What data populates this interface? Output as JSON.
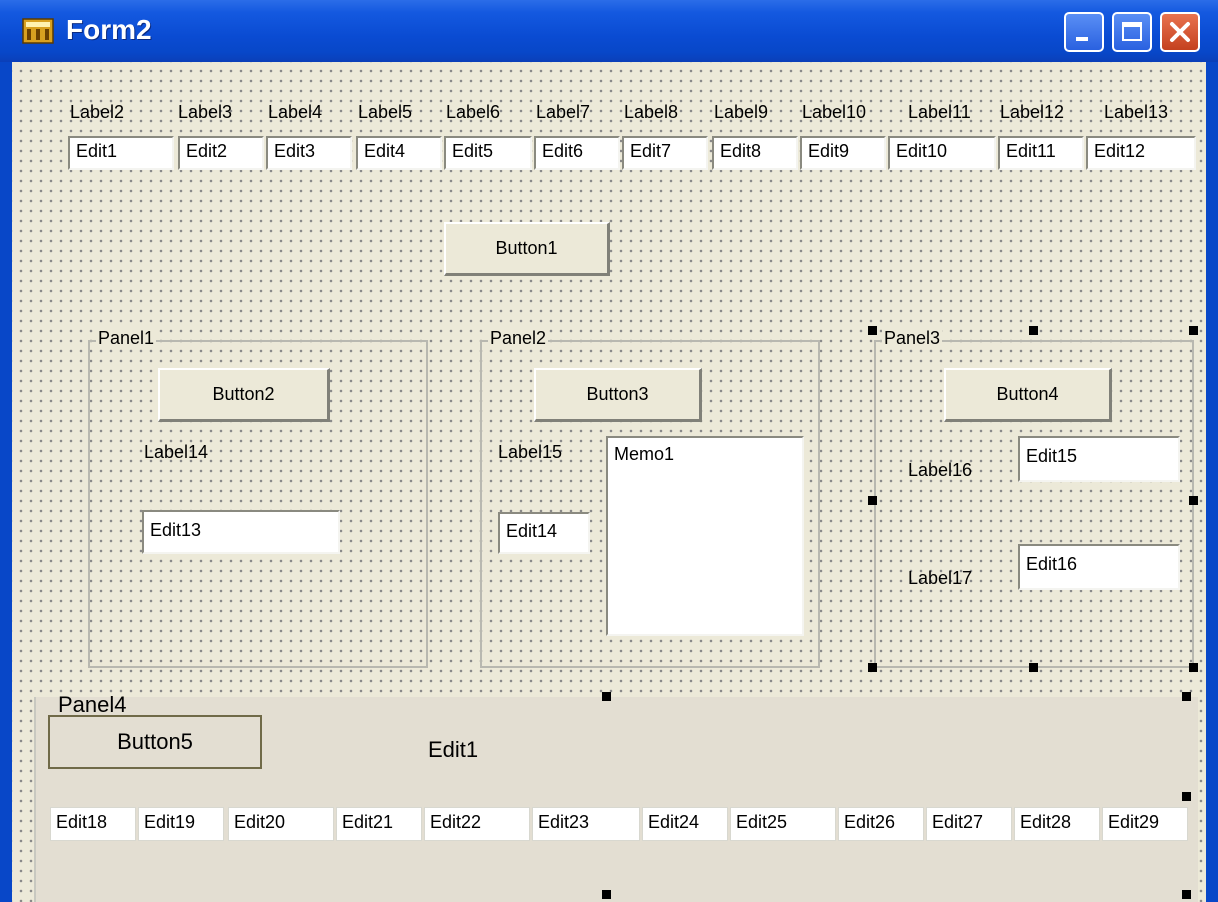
{
  "window": {
    "title": "Form2"
  },
  "top_labels": [
    "Label2",
    "Label3",
    "Label4",
    "Label5",
    "Label6",
    "Label7",
    "Label8",
    "Label9",
    "Label10",
    "Label11",
    "Label12",
    "Label13"
  ],
  "top_edits": [
    "Edit1",
    "Edit2",
    "Edit3",
    "Edit4",
    "Edit5",
    "Edit6",
    "Edit7",
    "Edit8",
    "Edit9",
    "Edit10",
    "Edit11",
    "Edit12"
  ],
  "button1": "Button1",
  "panel1": {
    "caption": "Panel1",
    "button": "Button2",
    "label": "Label14",
    "edit": "Edit13"
  },
  "panel2": {
    "caption": "Panel2",
    "button": "Button3",
    "label": "Label15",
    "edit": "Edit14",
    "memo": "Memo1"
  },
  "panel3": {
    "caption": "Panel3",
    "button": "Button4",
    "label_a": "Label16",
    "edit_a": "Edit15",
    "label_b": "Label17",
    "edit_b": "Edit16"
  },
  "panel4": {
    "caption": "Panel4",
    "button": "Button5",
    "edit_text": "Edit1",
    "edits": [
      "Edit18",
      "Edit19",
      "Edit20",
      "Edit21",
      "Edit22",
      "Edit23",
      "Edit24",
      "Edit25",
      "Edit26",
      "Edit27",
      "Edit28",
      "Edit29"
    ]
  }
}
